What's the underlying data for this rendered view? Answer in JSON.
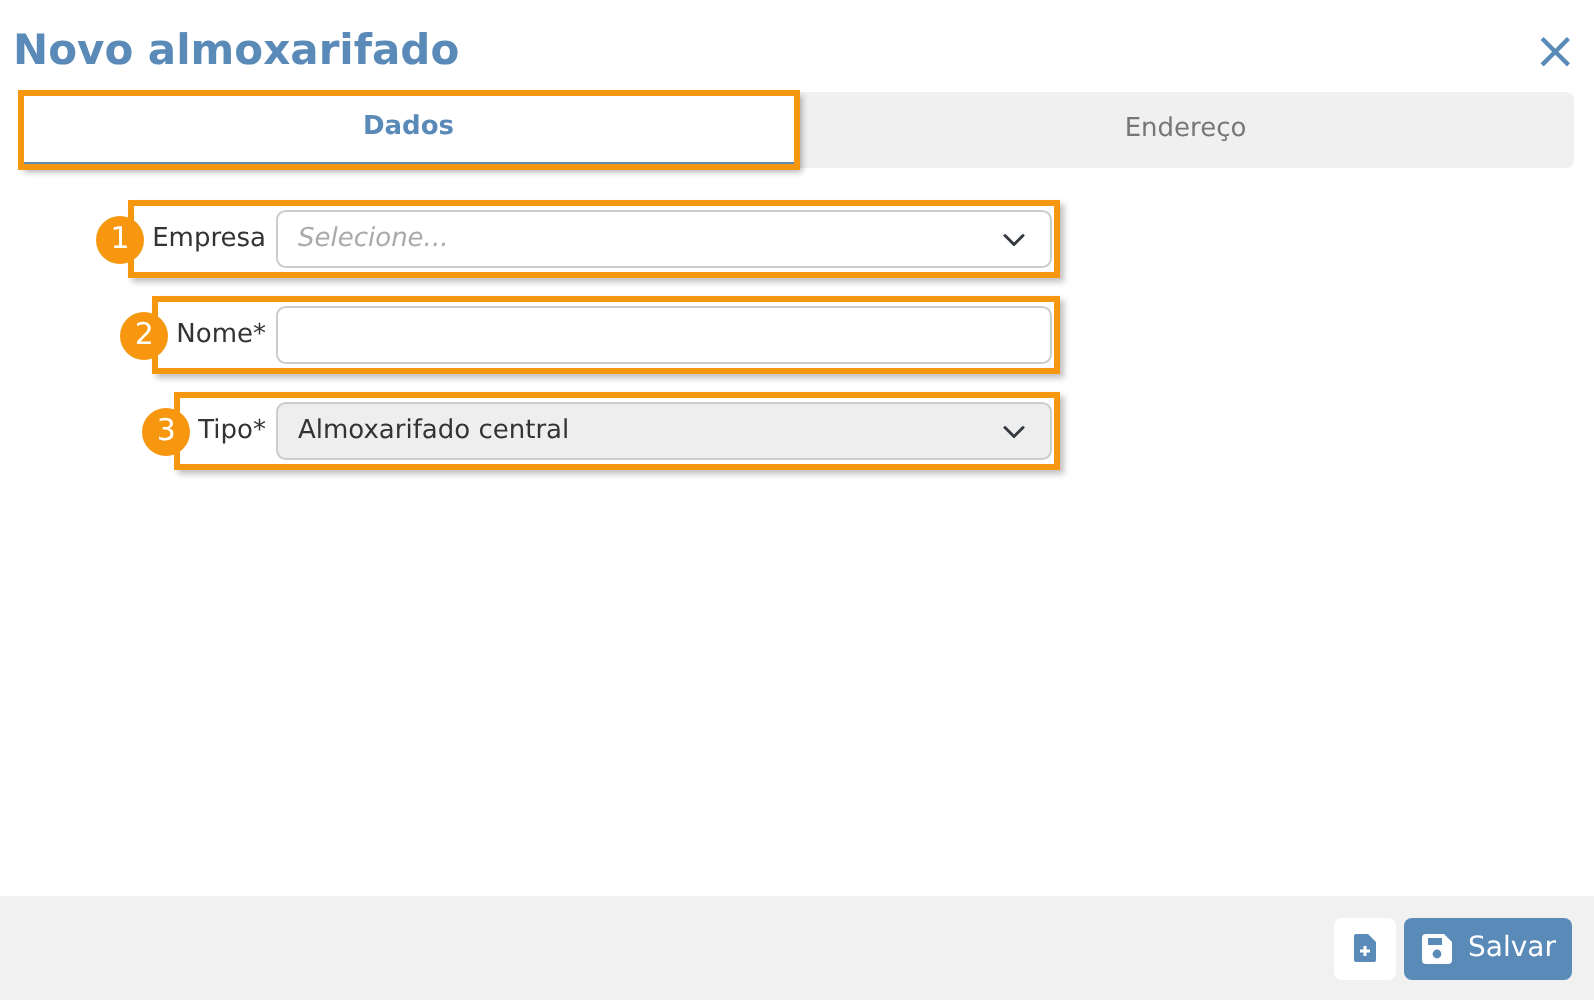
{
  "dialog": {
    "title": "Novo almoxarifado",
    "close": "×"
  },
  "tabs": [
    {
      "label": "Dados",
      "selected": true,
      "highlighted": true
    },
    {
      "label": "Endereço",
      "selected": false,
      "highlighted": false
    }
  ],
  "fields": [
    {
      "kind": "select",
      "label": "Empresa",
      "placeholder": "Selecione...",
      "disabled": false,
      "callout": "1"
    },
    {
      "kind": "text",
      "label": "Nome*",
      "disabled": false,
      "callout": "2"
    },
    {
      "kind": "select",
      "label": "Tipo*",
      "value": "Almoxarifado central",
      "disabled": true,
      "callout": "3"
    }
  ],
  "footer": {
    "save": "Salvar"
  }
}
